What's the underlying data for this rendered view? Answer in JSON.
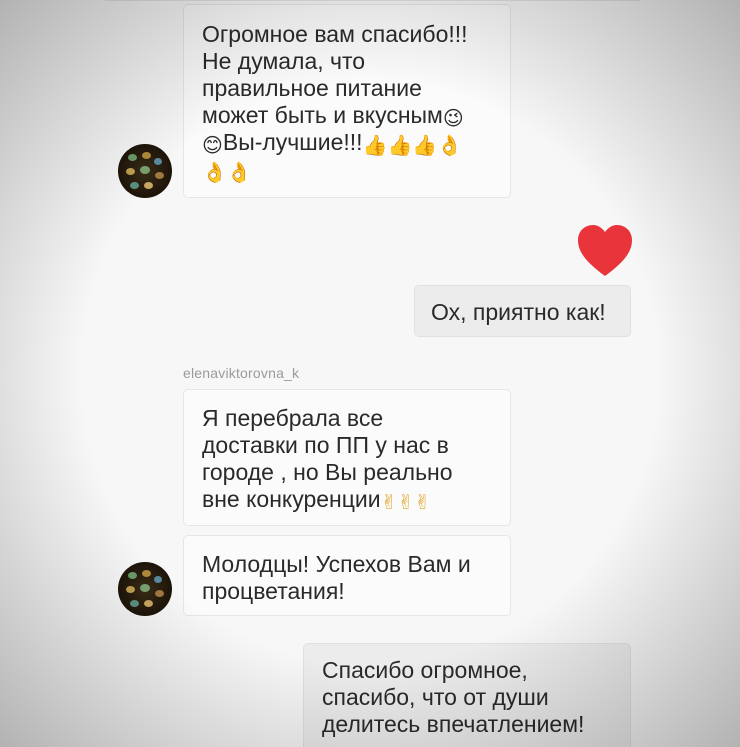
{
  "messages": [
    {
      "text": "Огромное вам спасибо!!!\nНе думала, что\nправильное питание\nможет быть и вкусным",
      "emoji_after": "😉",
      "line2_prefix_emoji": "😊",
      "line2_text": "Вы-лучшие!!!",
      "line2_emojis": "👍👍👍👌",
      "line3_emojis": "👌👌"
    },
    {
      "reaction_icon": "heart-icon",
      "reaction_color": "#e8343a"
    },
    {
      "text": "Ох, приятно как!"
    },
    {
      "username": "elenaviktorovna_k"
    },
    {
      "text": "Я перебрала все\nдоставки по ПП  у нас в\nгороде , но Вы реально\nвне конкуренции",
      "emoji_after": "✌✌✌"
    },
    {
      "text": "Молодцы! Успехов Вам и\nпроцветания!"
    },
    {
      "text": "Спасибо огромное,\nспасибо, что от души\nделитесь впечатлением!"
    }
  ]
}
